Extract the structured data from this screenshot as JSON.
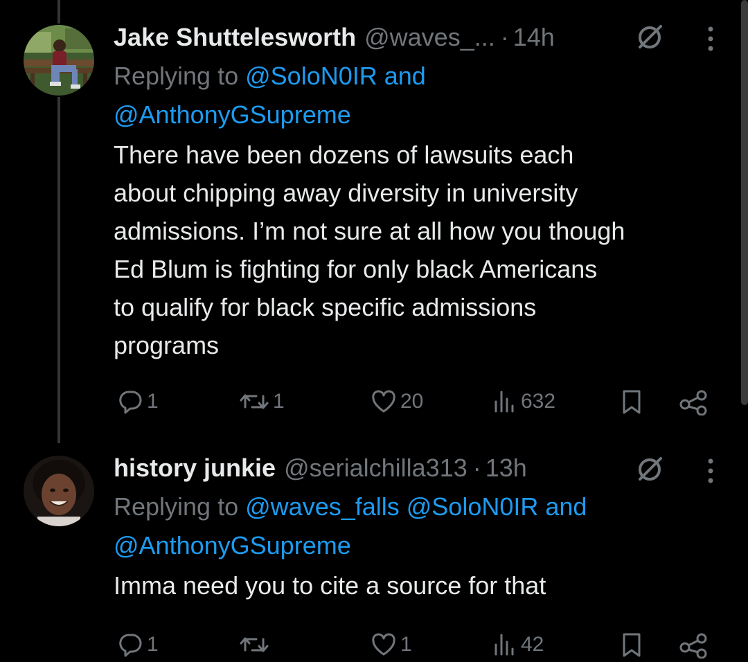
{
  "colors": {
    "background": "#000000",
    "text_primary": "#e7e9ea",
    "text_secondary": "#71767b",
    "link": "#1d9bf0",
    "thread_line": "#333639"
  },
  "tweets": [
    {
      "avatar_icon": "user-photo-on-bench",
      "display_name": "Jake Shuttelesworth",
      "handle": "@waves_...",
      "separator": "·",
      "time": "14h",
      "replying_prefix": "Replying to",
      "replying_mentions_line1": "@SoloN0IR and",
      "replying_mentions_line2": "@AnthonyGSupreme",
      "text_lines": [
        "There have been dozens of lawsuits each",
        "about chipping away diversity in university",
        "admissions. I’m not sure at all how you though",
        "Ed Blum is fighting for only black Americans",
        "to qualify for black specific admissions",
        "programs"
      ],
      "stats": {
        "replies": "1",
        "reposts": "1",
        "likes": "20",
        "views": "632"
      }
    },
    {
      "avatar_icon": "user-portrait-smiling",
      "display_name": "history junkie",
      "handle": "@serialchilla313",
      "separator": "·",
      "time": "13h",
      "replying_prefix": "Replying to",
      "replying_mentions_line1": "@waves_falls @SoloN0IR and",
      "replying_mentions_line2": "@AnthonyGSupreme",
      "text_lines": [
        "Imma need you to cite a source for that"
      ],
      "stats": {
        "replies": "1",
        "reposts": "",
        "likes": "1",
        "views": "42"
      }
    }
  ]
}
